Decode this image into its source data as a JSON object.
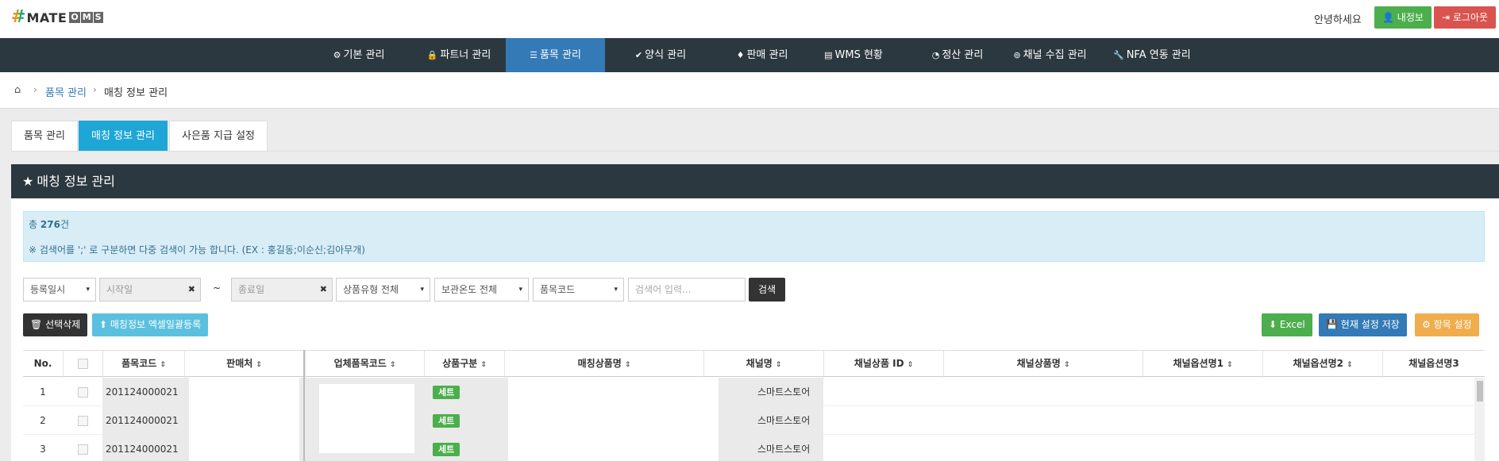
{
  "app": {
    "logo_hash": "#",
    "logo_mate": "MATE",
    "logo_oms": [
      "O",
      "M",
      "S"
    ],
    "greeting": "안녕하세요",
    "myinfo_label": "내정보",
    "logout_label": "로그아웃"
  },
  "nav": {
    "items": [
      {
        "icon": "⚙",
        "label": "기본 관리",
        "active": false
      },
      {
        "icon": "🔒",
        "label": "파트너 관리",
        "active": false
      },
      {
        "icon": "☰",
        "label": "품목 관리",
        "active": true
      },
      {
        "icon": "✔",
        "label": "양식 관리",
        "active": false
      },
      {
        "icon": "♦",
        "label": "판매 관리",
        "active": false
      },
      {
        "icon": "▤",
        "label": "WMS 현황",
        "active": false
      },
      {
        "icon": "◔",
        "label": "정산 관리",
        "active": false
      },
      {
        "icon": "⊚",
        "label": "채널 수집 관리",
        "active": false
      },
      {
        "icon": "🔧",
        "label": "NFA 연동 관리",
        "active": false
      }
    ]
  },
  "breadcrumb": {
    "home_icon": "⌂",
    "sep": "›",
    "link": "품목 관리",
    "current": "매칭 정보 관리"
  },
  "tabs": [
    {
      "label": "품목 관리",
      "active": false
    },
    {
      "label": "매칭 정보 관리",
      "active": true
    },
    {
      "label": "사은품 지급 설정",
      "active": false
    }
  ],
  "panel": {
    "star_icon": "★",
    "title": "매칭 정보 관리"
  },
  "alert": {
    "total_prefix": "총",
    "total_count": "276",
    "total_suffix": "건",
    "hint": "※ 검색어를 ';' 로 구분하면 다중 검색이 가능 합니다. (EX : 홍길동;이순신;김아무개)"
  },
  "filters": {
    "date_type": "등록일시",
    "start_placeholder": "시작일",
    "tilde": "~",
    "end_placeholder": "종료일",
    "product_type": "상품유형 전체",
    "storage_temp": "보관온도 전체",
    "search_field": "품목코드",
    "search_placeholder": "검색어 입력...",
    "search_button": "검색",
    "clear_icon": "✖",
    "caret_icon": "▾"
  },
  "actions": {
    "delete_selected": "선택삭제",
    "bulk_register": "매칭정보 엑셀일괄등록",
    "excel": "Excel",
    "save_settings": "현재 설정 저장",
    "column_settings": "항목 설정",
    "delete_icon": "🗑",
    "upload_icon": "⬆",
    "download_icon": "⬇",
    "save_icon": "💾",
    "gear_icon": "⚙"
  },
  "table": {
    "sort_icon": "⇕",
    "columns": [
      "No.",
      "",
      "품목코드",
      "판매처",
      "업체품목코드",
      "상품구분",
      "매칭상품명",
      "채널명",
      "채널상품 ID",
      "채널상품명",
      "채널옵션명1",
      "채널옵션명2",
      "채널옵션명3"
    ],
    "rows": [
      {
        "no": "1",
        "item_code": "201124000021",
        "product_type": "세트",
        "channel": "스마트스토어"
      },
      {
        "no": "2",
        "item_code": "201124000021",
        "product_type": "세트",
        "channel": "스마트스토어"
      },
      {
        "no": "3",
        "item_code": "201124000021",
        "product_type": "세트",
        "channel": "스마트스토어"
      }
    ]
  },
  "colors": {
    "nav_bg": "#2c3840",
    "nav_active": "#337ab7",
    "tab_active": "#1ea7d6",
    "green": "#4cae4c",
    "red": "#d9534f",
    "orange": "#f0ad4e",
    "info_bg": "#d9edf7"
  }
}
